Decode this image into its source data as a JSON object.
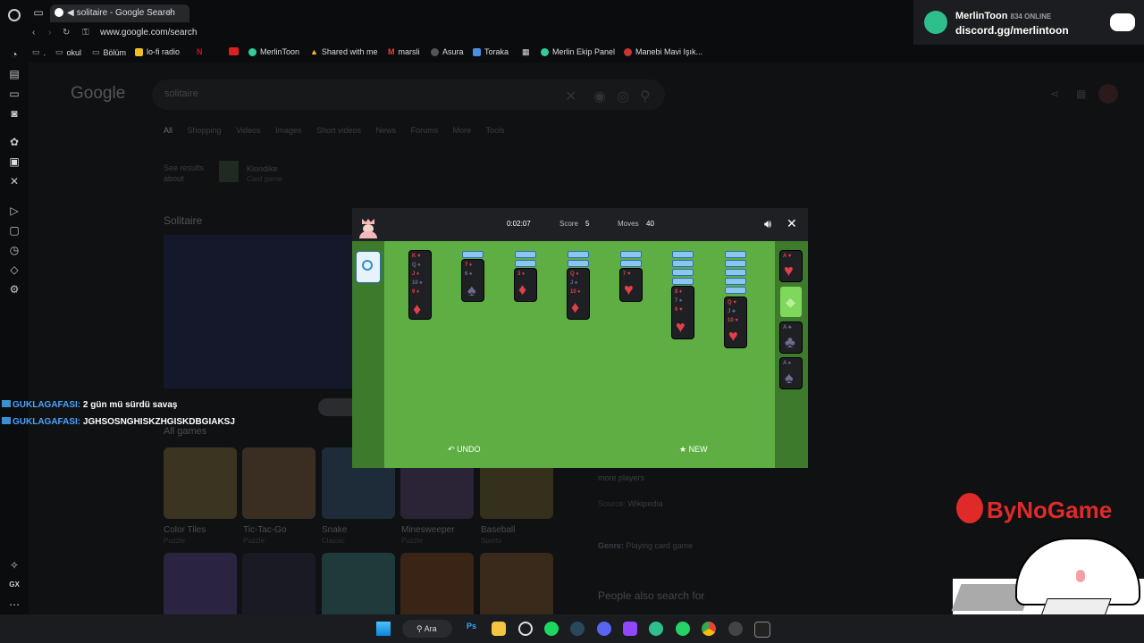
{
  "browser": {
    "tab_title": "solitaire - Google Search",
    "url": "www.google.com/search",
    "bookmarks": [
      ".",
      "okul",
      "Bölüm",
      "lo-fi radio",
      "MerlinToon",
      "Shared with me",
      "marsli",
      "Asura",
      "Toraka",
      "Merlin Ekip Panel",
      "Manebi Mavi Işık..."
    ]
  },
  "google": {
    "logo": "Google",
    "query": "solitaire",
    "filters": [
      "All",
      "Shopping",
      "Videos",
      "Images",
      "Short videos",
      "News",
      "Forums",
      "More",
      "Tools"
    ],
    "see_results_about": "See results about",
    "klondike_title": "Klondike",
    "klondike_sub": "Card game",
    "section_title": "Solitaire",
    "all_games_title": "All games",
    "games": [
      {
        "name": "Color Tiles",
        "genre": "Puzzle"
      },
      {
        "name": "Tic-Tac-Go",
        "genre": "Puzzle"
      },
      {
        "name": "Snake",
        "genre": "Classic"
      },
      {
        "name": "Minesweeper",
        "genre": "Puzzle"
      },
      {
        "name": "Baseball",
        "genre": "Sports"
      }
    ],
    "kp_more_players": "more players",
    "kp_source_label": "Source:",
    "kp_source": "Wikipedia",
    "kp_genre_label": "Genre:",
    "kp_genre": "Playing card game",
    "people_also_search": "People also search for"
  },
  "game": {
    "time": "0:02:07",
    "score_label": "Score",
    "score": "5",
    "moves_label": "Moves",
    "moves": "40",
    "undo_label": "UNDO",
    "new_label": "NEW"
  },
  "overlay": {
    "streamer_name": "MerlinToon",
    "online_count": "834 ONLINE",
    "discord_link": "discord.gg/merlintoon",
    "watermark": "ByNoGame",
    "chat": [
      {
        "user": "GUKLAGAFASI:",
        "message": "2 gün mü sürdü savaş"
      },
      {
        "user": "GUKLAGAFASI:",
        "message": "JGHSOSNGHISKZHGISKDBGIAKSJ"
      }
    ]
  },
  "taskbar": {
    "search_label": "Ara",
    "ps_label": "Ps"
  },
  "sidebar": {
    "gx_label": "GX"
  },
  "colors": {
    "felt": "#5fae44",
    "felt_dark": "#3e7a2c",
    "card_face": "#1e2024",
    "card_back": "#8cc6f0",
    "red_suit": "#e0404a",
    "black_suit": "#6a6d8e",
    "chat_user": "#4aa3ff"
  }
}
